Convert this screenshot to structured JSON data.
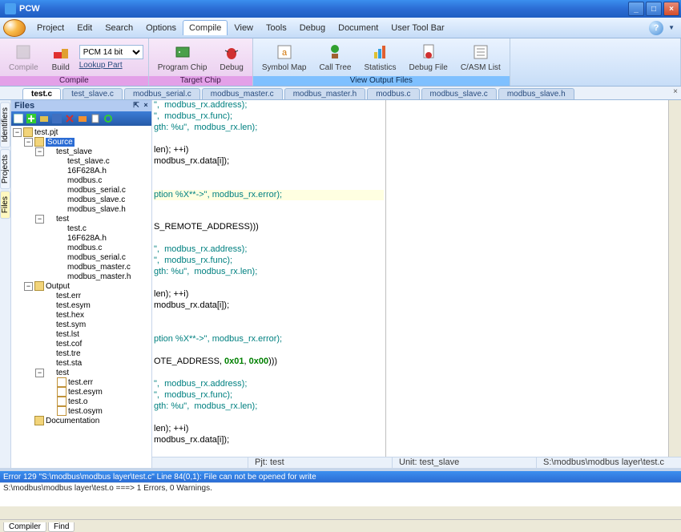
{
  "window": {
    "title": "PCW"
  },
  "menu": {
    "items": [
      "Project",
      "Edit",
      "Search",
      "Options",
      "Compile",
      "View",
      "Tools",
      "Debug",
      "Document",
      "User Tool Bar"
    ],
    "active_index": 4,
    "help_char": "?"
  },
  "ribbon": {
    "group_compile_label": "Compile",
    "group_target_label": "Target Chip",
    "group_view_label": "View Output Files",
    "compile_btn": "Compile",
    "build_btn": "Build",
    "chip_select_value": "PCM 14 bit",
    "lookup_part": "Lookup Part",
    "program_chip": "Program Chip",
    "debug": "Debug",
    "symbol_map": "Symbol Map",
    "call_tree": "Call Tree",
    "statistics": "Statistics",
    "debug_file": "Debug File",
    "casm_list": "C/ASM List"
  },
  "file_tabs": {
    "items": [
      "test.c",
      "test_slave.c",
      "modbus_serial.c",
      "modbus_master.c",
      "modbus_master.h",
      "modbus.c",
      "modbus_slave.c",
      "modbus_slave.h"
    ],
    "active_index": 0
  },
  "sidebar_tabs": {
    "identifiers": "Identifiers",
    "projects": "Projects",
    "files": "Files"
  },
  "files_panel": {
    "title": "Files",
    "pin_char": "⇱",
    "close_char": "×"
  },
  "tree": {
    "project": "test.pjt",
    "source_label": "Source",
    "test_slave_group": "test_slave",
    "test_slave_files": [
      "test_slave.c",
      "16F628A.h",
      "modbus.c",
      "modbus_serial.c",
      "modbus_slave.c",
      "modbus_slave.h"
    ],
    "test_group": "test",
    "test_files": [
      "test.c",
      "16F628A.h",
      "modbus.c",
      "modbus_serial.c",
      "modbus_master.c",
      "modbus_master.h"
    ],
    "output_label": "Output",
    "output_files": [
      "test.err",
      "test.esym",
      "test.hex",
      "test.sym",
      "test.lst",
      "test.cof",
      "test.tre",
      "test.sta"
    ],
    "output_test_group": "test",
    "output_test_files": [
      "test.err",
      "test.esym",
      "test.o",
      "test.osym"
    ],
    "documentation": "Documentation"
  },
  "code": {
    "l1": "\",  modbus_rx.address);",
    "l2": "\",  modbus_rx.func);",
    "l3": "gth: %u\",  modbus_rx.len);",
    "l4": "",
    "l5": "len); ++i)",
    "l6": "modbus_rx.data[i]);",
    "l7": "",
    "l8": "",
    "l9a": "ption %X**->\", modbus_rx.error);",
    "l10": "",
    "l11": "S_REMOTE_ADDRESS)))",
    "l12": "",
    "l13": "\",  modbus_rx.address);",
    "l14": "\",  modbus_rx.func);",
    "l15": "gth: %u\",  modbus_rx.len);",
    "l16": "",
    "l17": "len); ++i)",
    "l18": "modbus_rx.data[i]);",
    "l19": "",
    "l20": "",
    "l21": "ption %X**->\", modbus_rx.error);",
    "l22": "",
    "l23a": "OTE_ADDRESS,",
    "l23b": " 0x01",
    "l23c": ", ",
    "l23d": "0x00",
    "l23e": ")))",
    "l24": "",
    "l25": "\",  modbus_rx.address);",
    "l26": "\",  modbus_rx.func);",
    "l27": "gth: %u\",  modbus_rx.len);",
    "l28": "",
    "l29": "len); ++i)",
    "l30": "modbus_rx.data[i]);",
    "l31": "",
    "l32": "",
    "l33": "",
    "l34": "ption %X**->\", modbus_rx.error);"
  },
  "status": {
    "pjt": "Pjt: test",
    "unit": "Unit: test_slave",
    "path": "S:\\modbus\\modbus layer\\test.c"
  },
  "messages": {
    "error": "Error 129 \"S:\\modbus\\modbus layer\\test.c\" Line 84(0,1): File can not be opened for write",
    "summary": "S:\\modbus\\modbus layer\\test.o ===>  1 Errors,  0 Warnings."
  },
  "bottom_tabs": {
    "compiler": "Compiler",
    "find": "Find"
  }
}
